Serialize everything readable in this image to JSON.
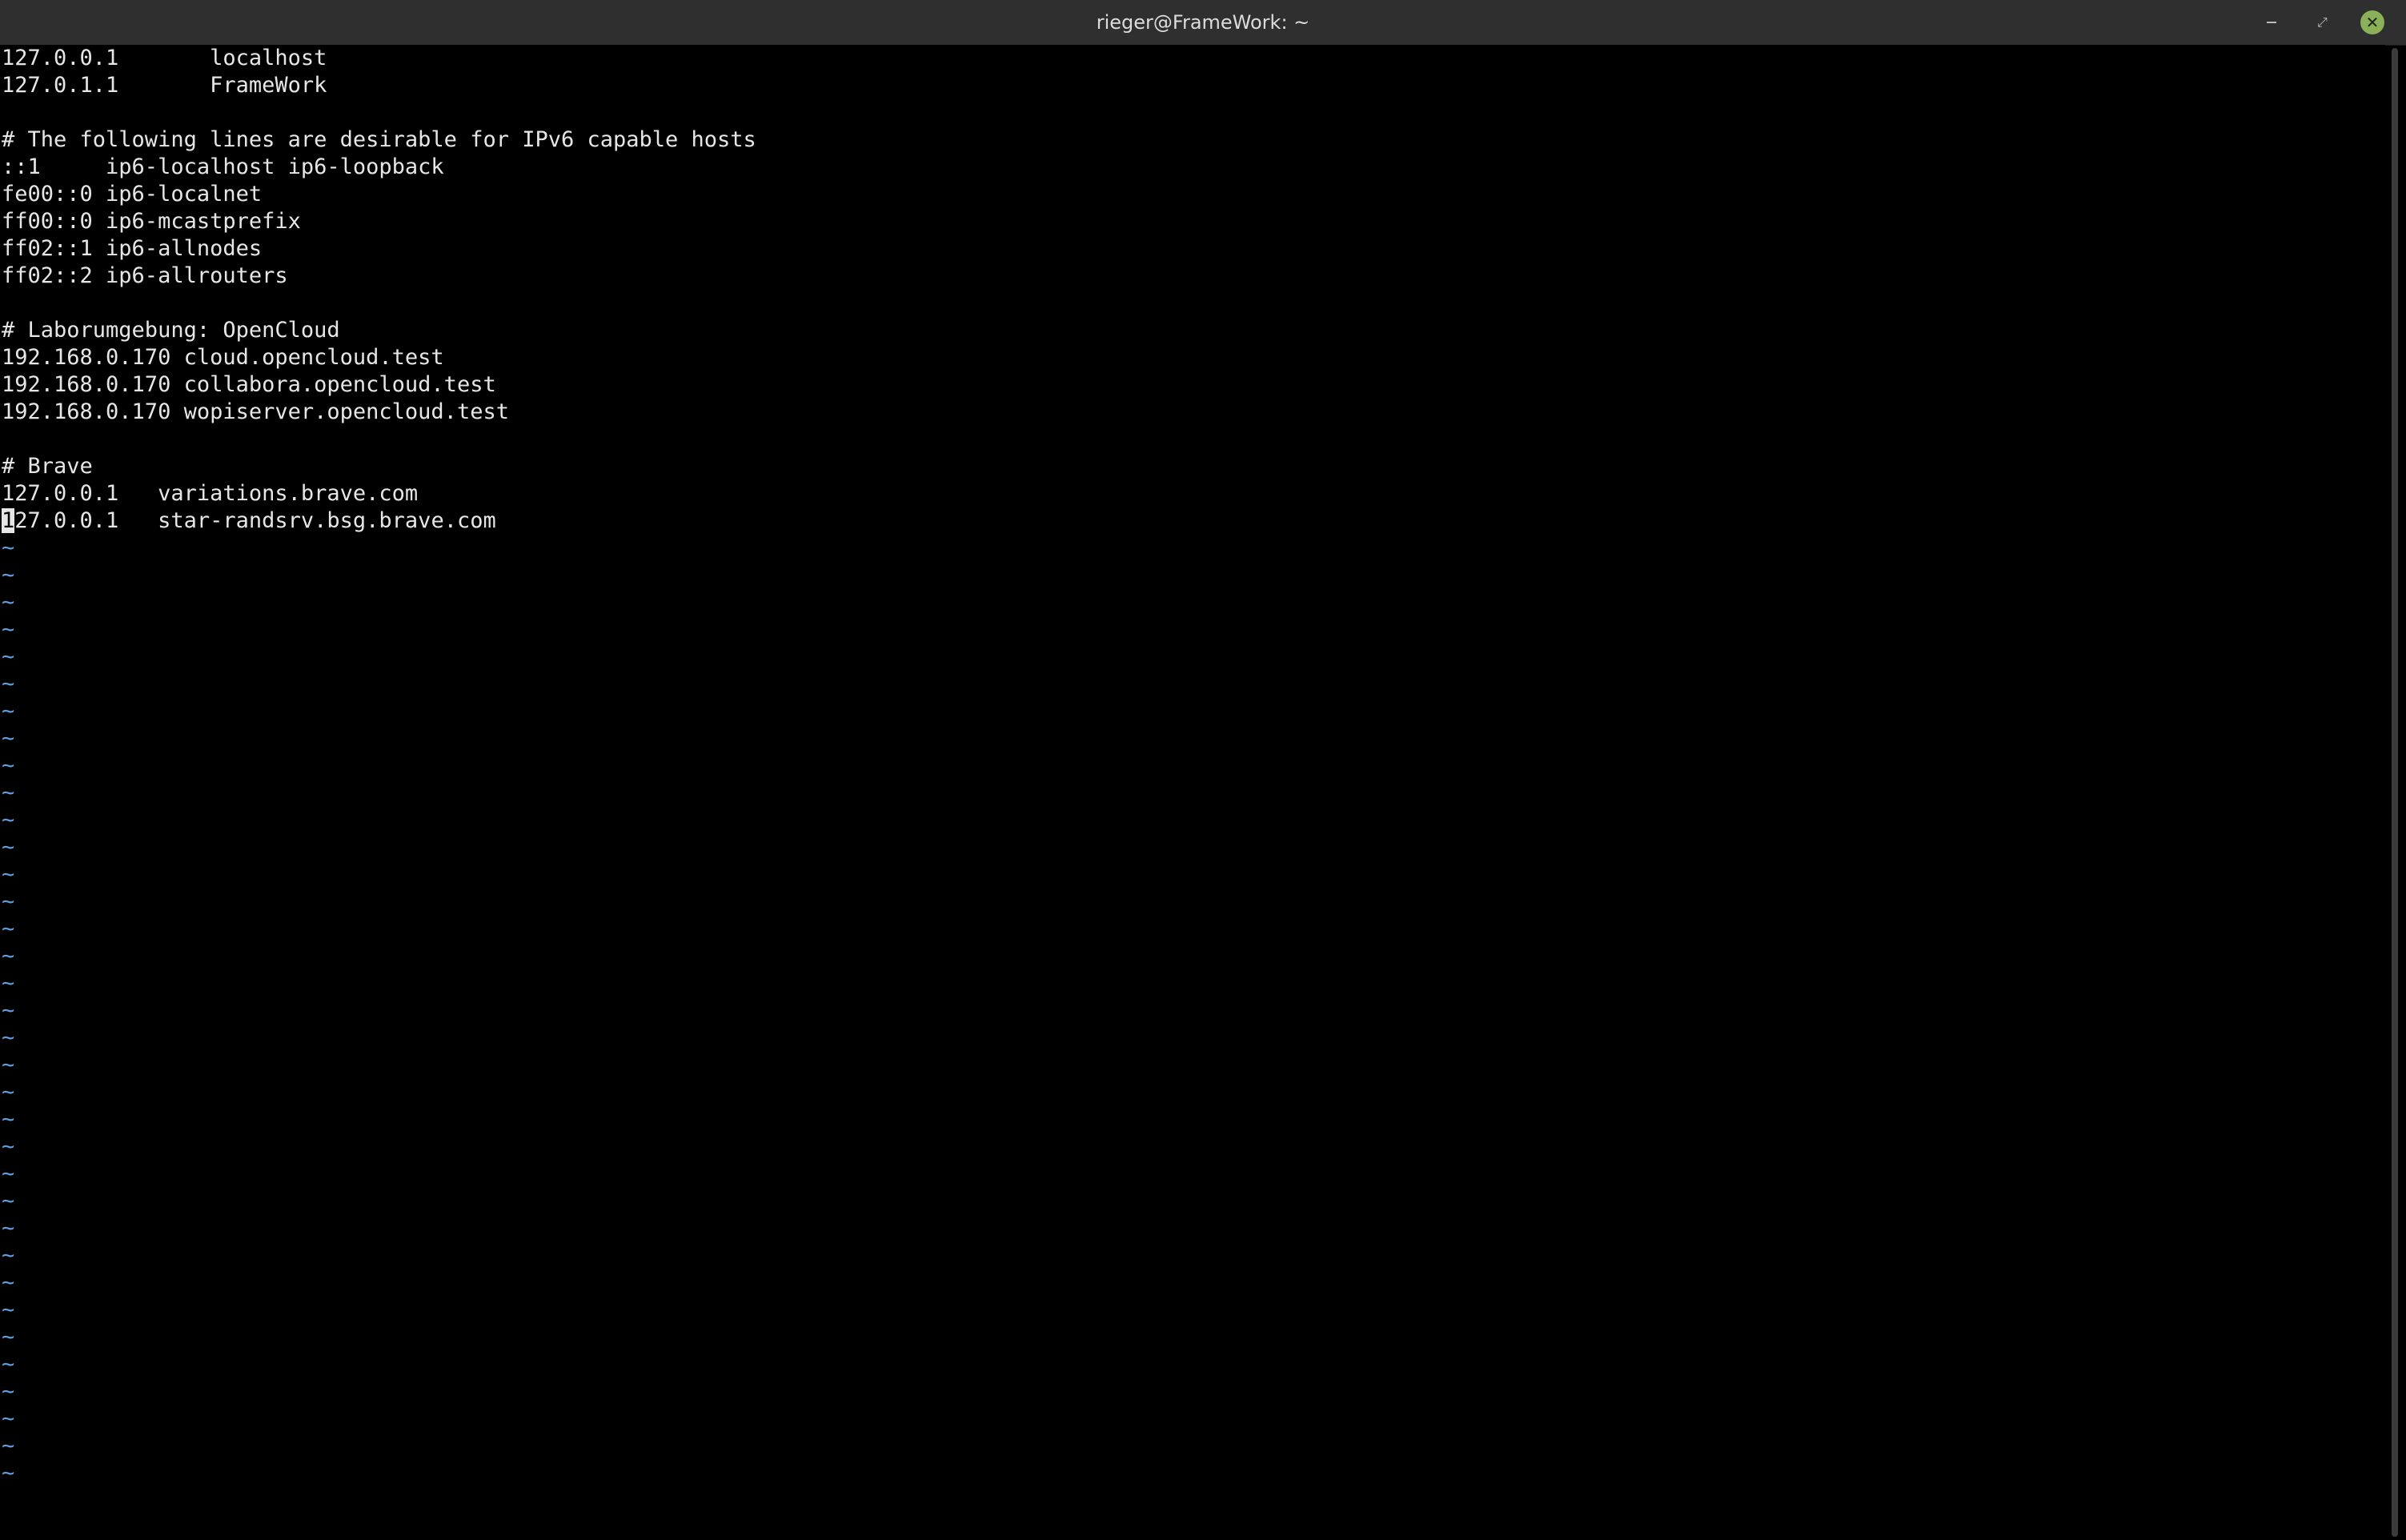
{
  "window": {
    "title": "rieger@FrameWork: ~",
    "buttons": {
      "minimize": "–",
      "maximize": "⤢",
      "close": "✕"
    },
    "close_color": "#8bb158"
  },
  "editor": {
    "lines": [
      "127.0.0.1       localhost",
      "127.0.1.1       FrameWork",
      "",
      "# The following lines are desirable for IPv6 capable hosts",
      "::1     ip6-localhost ip6-loopback",
      "fe00::0 ip6-localnet",
      "ff00::0 ip6-mcastprefix",
      "ff02::1 ip6-allnodes",
      "ff02::2 ip6-allrouters",
      "",
      "# Laborumgebung: OpenCloud",
      "192.168.0.170 cloud.opencloud.test",
      "192.168.0.170 collabora.opencloud.test",
      "192.168.0.170 wopiserver.opencloud.test",
      "",
      "# Brave",
      "127.0.0.1   variations.brave.com"
    ],
    "cursor_line": {
      "cursor_char": "1",
      "rest": "27.0.0.1   star-randsrv.bsg.brave.com"
    },
    "empty_line_marker": "~",
    "empty_line_count": 35,
    "tilde_color": "#5ea0e0",
    "text_color": "#e6e6e6"
  }
}
